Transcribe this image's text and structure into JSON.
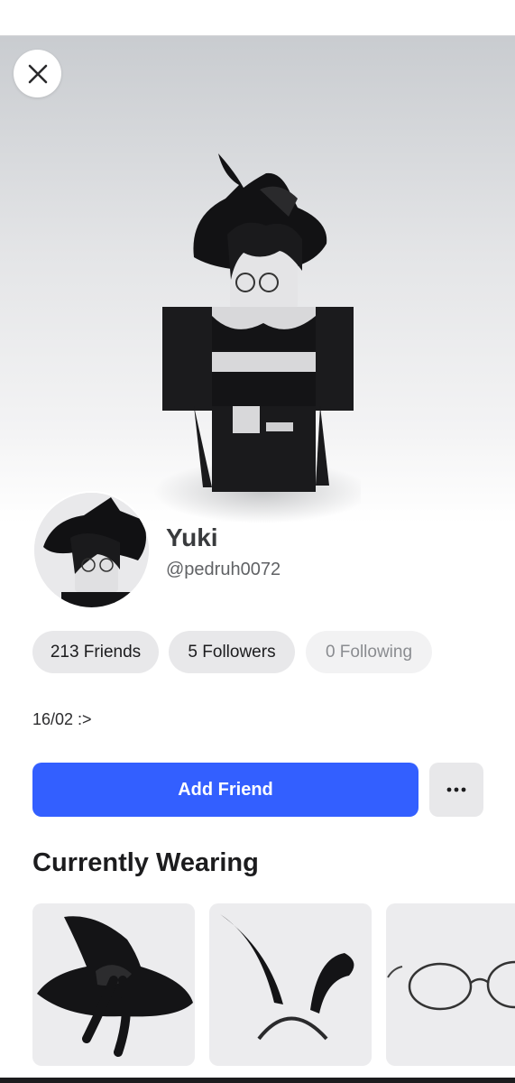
{
  "close": {
    "icon": "close-icon"
  },
  "avatar": {
    "icon": "avatar-3d-figure"
  },
  "profile": {
    "display_name": "Yuki",
    "username": "@pedruh0072",
    "status": "16/02 :>"
  },
  "stats": {
    "friends_label": "213 Friends",
    "followers_label": "5 Followers",
    "following_label": "0 Following"
  },
  "actions": {
    "add_friend_label": "Add Friend",
    "more_icon": "ellipsis-icon"
  },
  "currently_wearing": {
    "title": "Currently Wearing",
    "items": [
      {
        "icon": "witch-hat-icon"
      },
      {
        "icon": "bunny-ears-icon"
      },
      {
        "icon": "glasses-icon"
      }
    ]
  },
  "colors": {
    "accent": "#335fff",
    "chip_bg": "#e8e8ea",
    "muted_text": "#8a8c90"
  }
}
